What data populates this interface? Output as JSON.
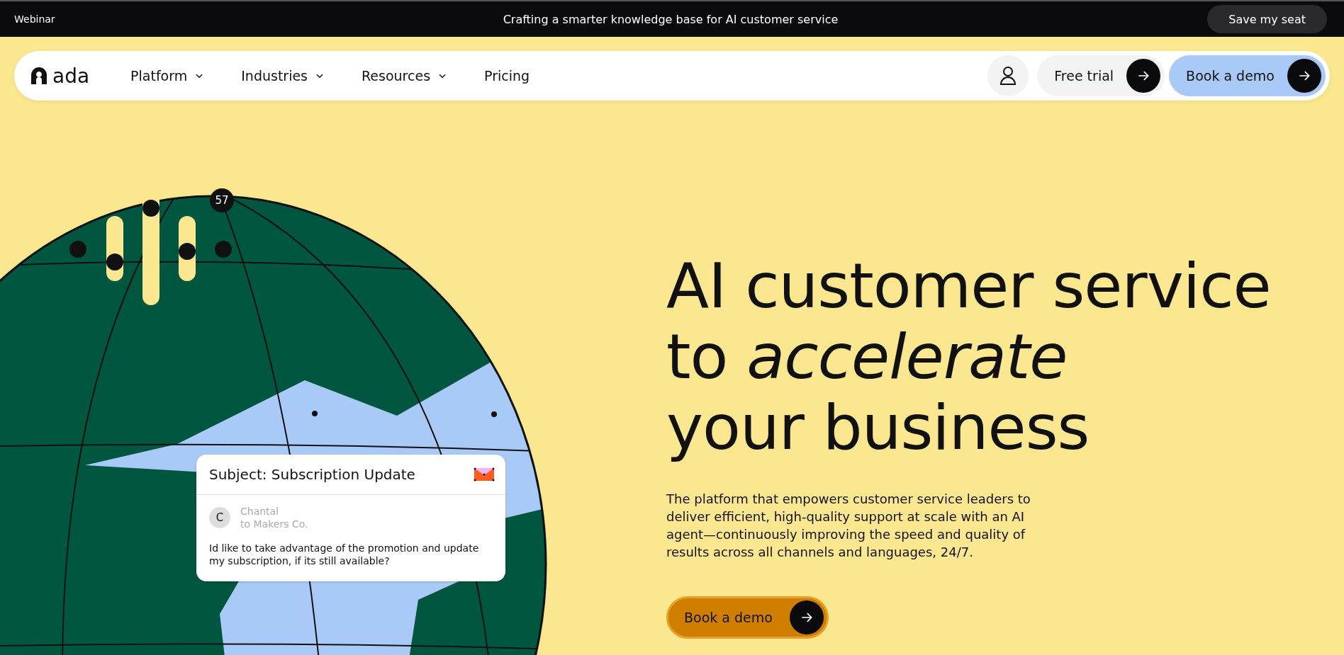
{
  "announcement": {
    "label": "Webinar",
    "text": "Crafting a smarter knowledge base for AI customer service",
    "button": "Save my seat"
  },
  "nav": {
    "logo": "ada",
    "items": [
      {
        "label": "Platform",
        "dropdown": true
      },
      {
        "label": "Industries",
        "dropdown": true
      },
      {
        "label": "Resources",
        "dropdown": true
      },
      {
        "label": "Pricing",
        "dropdown": false
      }
    ],
    "free_trial": "Free trial",
    "book_demo": "Book a demo"
  },
  "hero": {
    "headline": [
      "AI customer service",
      "to *accelerate*",
      "your business"
    ],
    "description": "The platform that empowers customer service leaders to deliver efficient, high-quality support at scale with an AI agent—continuously improving the speed and quality of results across all channels and languages, 24/7.",
    "cta": "Book a demo",
    "globe": {
      "badge": "57",
      "email": {
        "subject": "Subject: Subscription Update",
        "avatar": "C",
        "sender": "Chantal",
        "recipient": "to Makers Co.",
        "body": "Id like to take advantage of the promotion and update my subscription, if its still available?"
      }
    }
  }
}
